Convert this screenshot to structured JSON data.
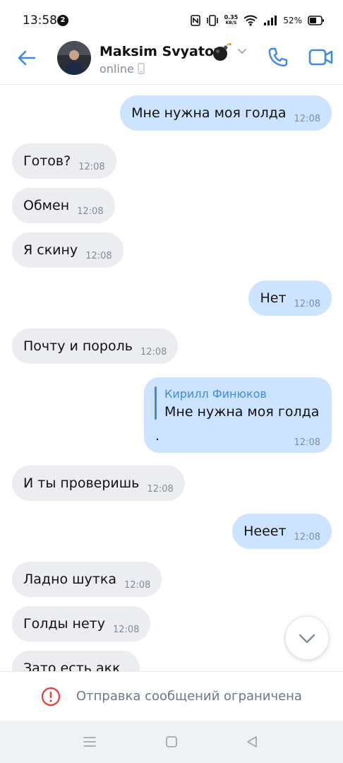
{
  "status_bar": {
    "time": "13:58",
    "notification_count": "2",
    "net_speed_value": "0.35",
    "net_speed_unit": "KB/S",
    "battery": "52%"
  },
  "header": {
    "name": "Maksim Svyatov",
    "status": "online",
    "name_emoji": "bomb-icon",
    "accent_color": "#3f8ae0"
  },
  "messages": [
    {
      "direction": "out",
      "text": "Мне нужна моя голда",
      "time": "12:08"
    },
    {
      "direction": "in",
      "text": "Готов?",
      "time": "12:08"
    },
    {
      "direction": "in",
      "text": "Обмен",
      "time": "12:08"
    },
    {
      "direction": "in",
      "text": "Я скину",
      "time": "12:08"
    },
    {
      "direction": "out",
      "text": "Нет",
      "time": "12:08"
    },
    {
      "direction": "in",
      "text": "Почту и пороль",
      "time": "12:08"
    },
    {
      "direction": "out",
      "reply_author": "Кирилл Финюков",
      "reply_text": "Мне нужна моя голда",
      "text": ".",
      "time": "12:08"
    },
    {
      "direction": "in",
      "text": "И ты проверишь",
      "time": "12:08"
    },
    {
      "direction": "out",
      "text": "Нееет",
      "time": "12:08"
    },
    {
      "direction": "in",
      "text": "Ладно шутка",
      "time": "12:08"
    },
    {
      "direction": "in",
      "text": "Голды нету",
      "time": "12:08"
    },
    {
      "direction": "in",
      "text": "Зато есть акк",
      "time": ""
    }
  ],
  "restriction": {
    "text": "Отправка сообщений ограничена",
    "icon": "alert-circle-icon",
    "color": "#e64646"
  },
  "colors": {
    "incoming_bubble": "#ebedf0",
    "outgoing_bubble": "#cce4ff",
    "time_text": "#818c99"
  }
}
